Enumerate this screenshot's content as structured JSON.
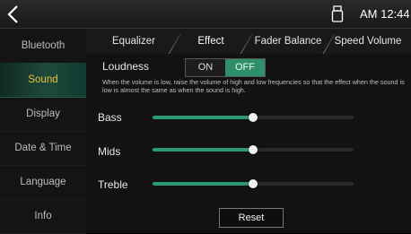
{
  "status_bar": {
    "time": "AM 12:44",
    "usb_icon": "usb-drive-icon",
    "back_icon": "chevron-left-icon"
  },
  "sidebar": {
    "items": [
      {
        "label": "Bluetooth",
        "active": false
      },
      {
        "label": "Sound",
        "active": true
      },
      {
        "label": "Display",
        "active": false
      },
      {
        "label": "Date & Time",
        "active": false
      },
      {
        "label": "Language",
        "active": false
      },
      {
        "label": "Info",
        "active": false
      }
    ]
  },
  "tabs": [
    {
      "label": "Equalizer",
      "active": false
    },
    {
      "label": "Effect",
      "active": true
    },
    {
      "label": "Fader Balance",
      "active": false
    },
    {
      "label": "Speed Volume",
      "active": false
    }
  ],
  "loudness": {
    "label": "Loudness",
    "on_label": "ON",
    "off_label": "OFF",
    "selected": "OFF",
    "description": "When the volume is low, raise the volume of high and low frequencies so that the effect when the sound is low is almost the same as when the sound is high."
  },
  "sliders": [
    {
      "label": "Bass",
      "value": 0.5
    },
    {
      "label": "Mids",
      "value": 0.5
    },
    {
      "label": "Treble",
      "value": 0.5
    }
  ],
  "reset_label": "Reset",
  "colors": {
    "accent": "#2c9a74",
    "active_text": "#e8c23d",
    "background": "#121212"
  }
}
